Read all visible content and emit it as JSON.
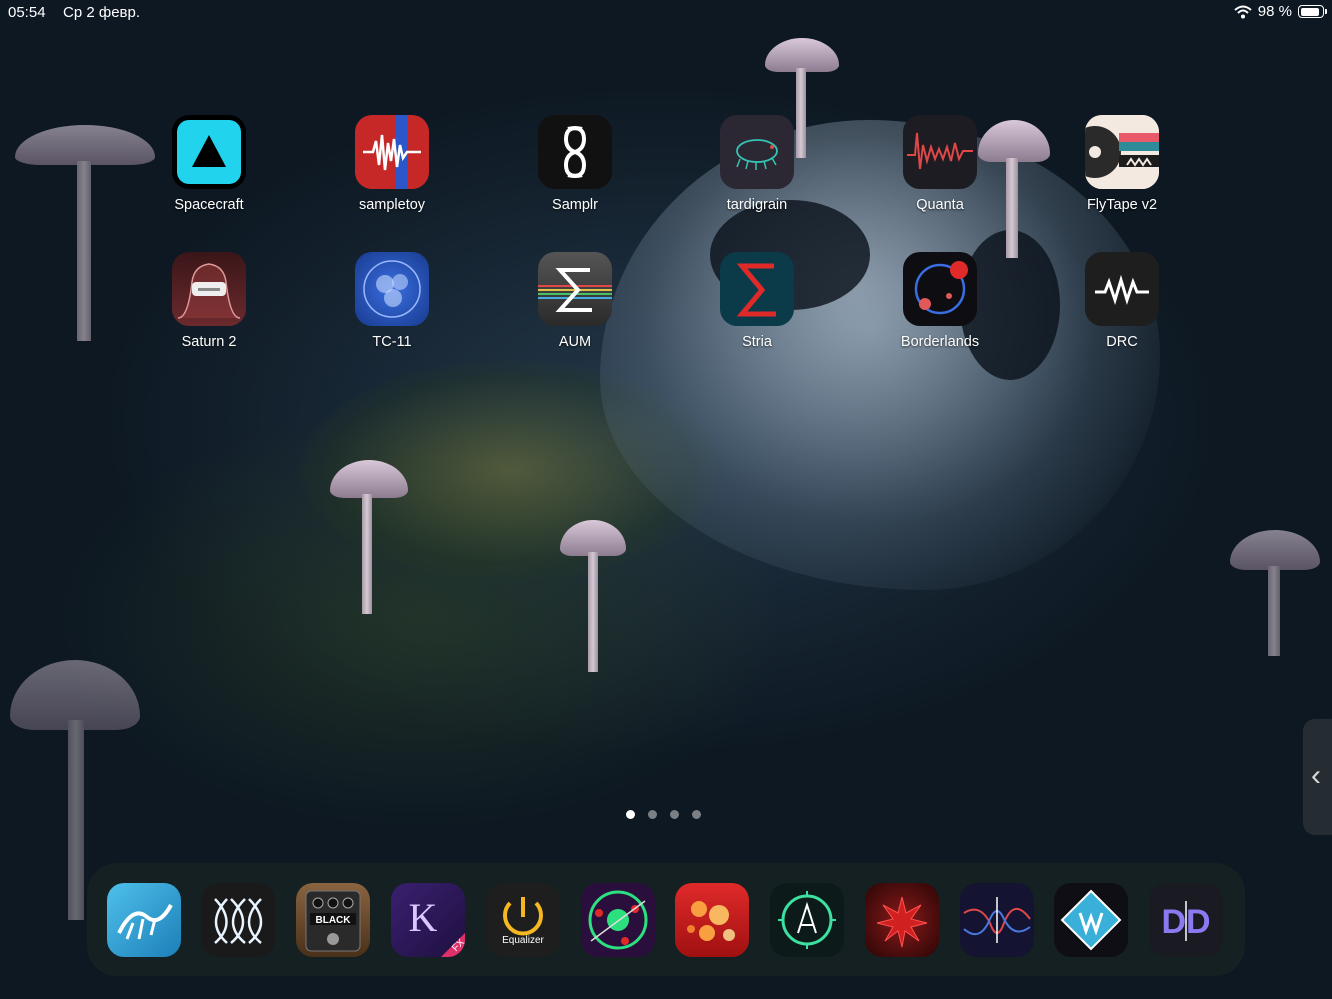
{
  "status_bar": {
    "time": "05:54",
    "date": "Ср 2 февр.",
    "battery_percent": "98 %",
    "battery_level": 0.98
  },
  "home_screen": {
    "apps": [
      {
        "label": "Spacecraft",
        "icon": "triangle-icon",
        "color": "#22d3ee"
      },
      {
        "label": "sampletoy",
        "icon": "waveform-icon",
        "color": "#c62828"
      },
      {
        "label": "Samplr",
        "icon": "s-curve-icon",
        "color": "#111111"
      },
      {
        "label": "tardigrain",
        "icon": "tardigrade-icon",
        "color": "#2b2733"
      },
      {
        "label": "Quanta",
        "icon": "wave-line-icon",
        "color": "#1c1c22"
      },
      {
        "label": "FlyTape v2",
        "icon": "tape-reel-icon",
        "color": "#f3e9e0"
      },
      {
        "label": "Saturn 2",
        "icon": "saturation-curve-icon",
        "color": "#5a1e22"
      },
      {
        "label": "TC-11",
        "icon": "circles-icon",
        "color": "#1d4fb8"
      },
      {
        "label": "AUM",
        "icon": "sigma-icon",
        "color": "#3a3a3a"
      },
      {
        "label": "Stria",
        "icon": "sigma-red-icon",
        "color": "#0b3a48"
      },
      {
        "label": "Borderlands",
        "icon": "orbit-dots-icon",
        "color": "#0d0d12"
      },
      {
        "label": "DRC",
        "icon": "resistor-icon",
        "color": "#1e1e1e"
      }
    ]
  },
  "page_indicator": {
    "pages": 4,
    "active": 0
  },
  "dock": {
    "apps": [
      {
        "icon": "wave-bridge-icon",
        "color": "#3aa8d8"
      },
      {
        "icon": "lattice-icon",
        "color": "#1a1a1a"
      },
      {
        "icon": "pedal-icon",
        "color": "#6b4a2c",
        "text": "BLACK"
      },
      {
        "icon": "letter-k-icon",
        "color": "#2e1a5c",
        "text": "K"
      },
      {
        "icon": "power-equalizer-icon",
        "color": "#1e1e1e",
        "text": "Equalizer"
      },
      {
        "icon": "orbit-green-icon",
        "color": "#2a0f3c"
      },
      {
        "icon": "red-bubbles-icon",
        "color": "#d42020"
      },
      {
        "icon": "compass-a-icon",
        "color": "#0d1a1a"
      },
      {
        "icon": "red-burst-icon",
        "color": "#3a0a0a"
      },
      {
        "icon": "filter-curve-icon",
        "color": "#141432"
      },
      {
        "icon": "diamond-logo-icon",
        "color": "#0e0e14"
      },
      {
        "icon": "dd-logo-icon",
        "color": "#1a1a22",
        "text": "DD"
      }
    ]
  }
}
